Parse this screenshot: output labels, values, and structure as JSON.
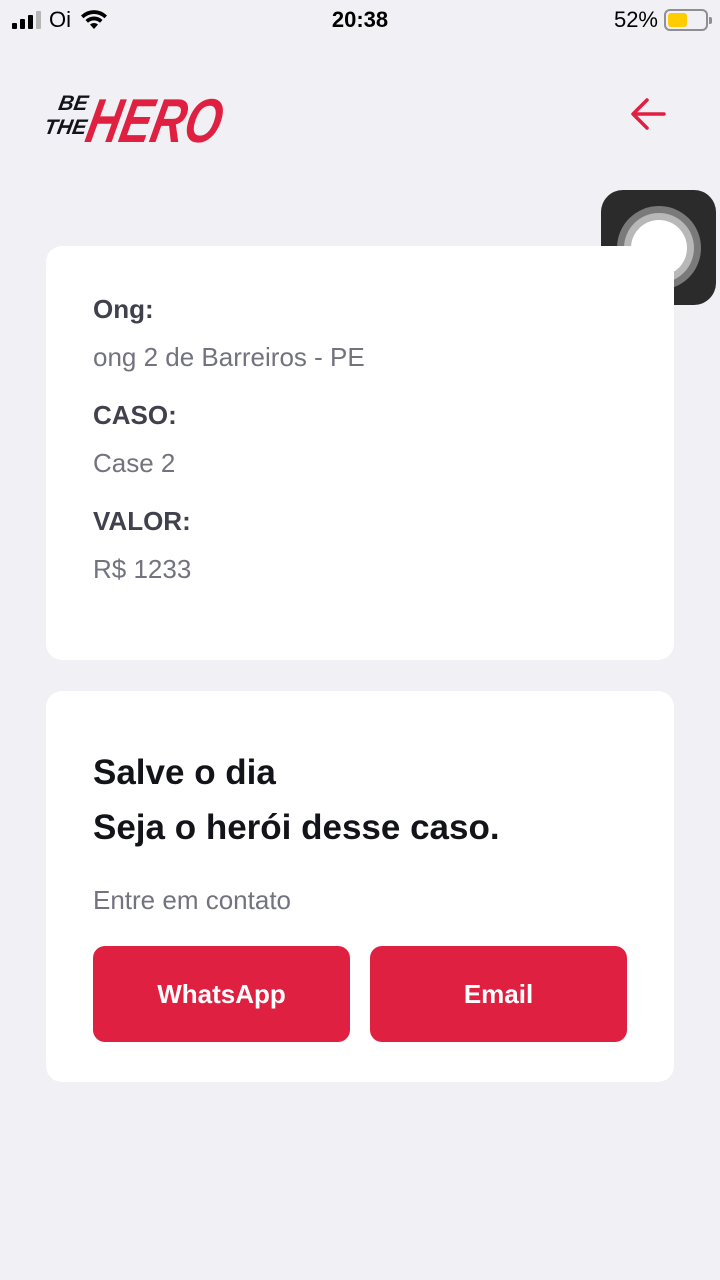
{
  "status_bar": {
    "carrier": "Oi",
    "time": "20:38",
    "battery_percent": "52%",
    "battery_level": 0.52
  },
  "header": {
    "logo_text_top": "BE",
    "logo_text_mid": "THE",
    "logo_text_hero": "HERO",
    "back_icon": "arrow-left-icon"
  },
  "incident": {
    "ong_label": "Ong:",
    "ong_value": "ong 2 de Barreiros - PE",
    "case_label": "CASO:",
    "case_value": "Case 2",
    "value_label": "VALOR:",
    "value_value": "R$ 1233"
  },
  "contact": {
    "title_line1": "Salve o dia",
    "title_line2": "Seja o herói desse caso.",
    "description": "Entre em contato",
    "whatsapp_label": "WhatsApp",
    "email_label": "Email"
  },
  "colors": {
    "accent": "#e02041",
    "background": "#f0f0f5"
  }
}
